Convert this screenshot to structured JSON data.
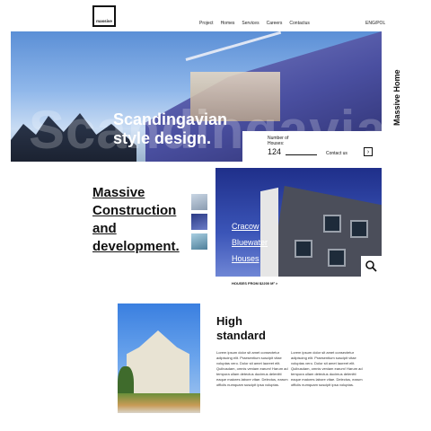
{
  "header": {
    "logo": "massive",
    "nav": [
      "Project",
      "Homes",
      "Services",
      "Careers",
      "Contactus"
    ],
    "lang": "ENG/POL"
  },
  "hero": {
    "title": "Scandingavian style design.",
    "watermark": "Scandingavia",
    "info_label": "Number of Houses:",
    "info_value": "124",
    "contact_label": "Contact us",
    "vertical_label": "Massive Home"
  },
  "about": {
    "title": "Massive Construction and development."
  },
  "project": {
    "name_lines": [
      "Cracow",
      "Bluewater",
      "Houses"
    ],
    "price_note": "HOUSES FROM $2200 M² >"
  },
  "standard": {
    "title": "High standard",
    "col1": "Lorem ipsum dolor sit amet consectetur adipiscing elit. Praesentium suscipit vitae voluptas vero. Dolor sit amet laoreet elit. Quibusdam, omnis veniam earum! Harum ad tempora ullam detectus ducimus delenitti eaque maiores labore vitae. Delectus, earum officiis numquam suscipit ipsa voluptas.",
    "col2": "Lorem ipsum dolor sit amet consectetur adipiscing elit. Praesentium suscipit vitae voluptas vero. Dolor sit amet laoreet elit. Quibusdam, omnis veniam earum! Harum ad tempora ullam detectus ducimus delenitti eaque maiores labore vitae. Delectus, earum officiis numquam suscipit ipsa voluptas."
  }
}
